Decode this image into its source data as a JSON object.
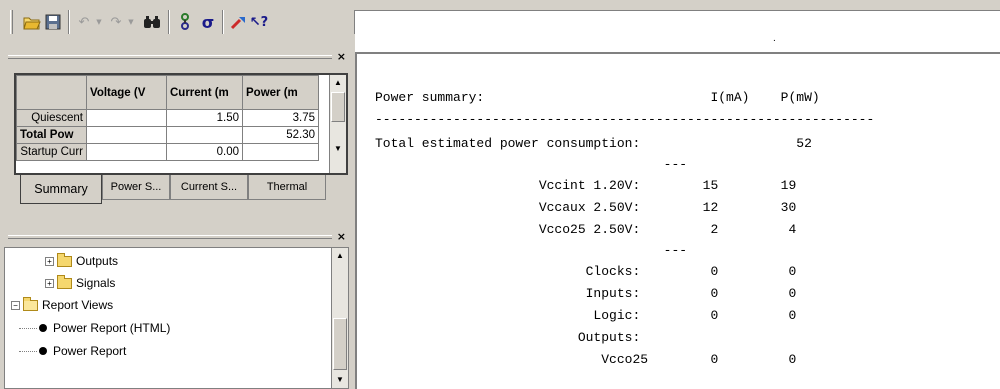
{
  "toolbar": {
    "icons": [
      "open-folder-icon",
      "save-icon",
      "undo-icon",
      "redo-icon",
      "find-icon",
      "hierarchy-icon",
      "sigma-icon",
      "run-icon",
      "help-pointer-icon"
    ],
    "sigma_label": "σ",
    "right_dot": "."
  },
  "summary_pane": {
    "columns": [
      "Voltage (V",
      "Current (m",
      "Power (m"
    ],
    "rows": [
      {
        "label": "Quiescent",
        "voltage": "",
        "current": "1.50",
        "power": "3.75"
      },
      {
        "label": "Total Pow",
        "voltage": "",
        "current": "",
        "power": "52.30"
      },
      {
        "label": "Startup Curr",
        "voltage": "",
        "current": "0.00",
        "power": ""
      }
    ],
    "tabs": [
      "Summary",
      "Power S...",
      "Current S...",
      "Thermal"
    ]
  },
  "tree_pane": {
    "nodes": [
      {
        "label": "Outputs",
        "type": "folder-collapsed"
      },
      {
        "label": "Signals",
        "type": "folder-collapsed"
      },
      {
        "label": "Report Views",
        "type": "folder-expanded"
      },
      {
        "label": "Power Report (HTML)",
        "type": "leaf"
      },
      {
        "label": "Power Report",
        "type": "leaf"
      }
    ]
  },
  "report": {
    "lines": [
      "Power summary:                             I(mA)    P(mW)",
      "----------------------------------------------------------------",
      "Total estimated power consumption:                    52",
      "                                     ---",
      "                     Vccint 1.20V:        15        19",
      "                     Vccaux 2.50V:        12        30",
      "                     Vcco25 2.50V:         2         4",
      "                                     ---",
      "                           Clocks:         0         0",
      "                           Inputs:         0         0",
      "                            Logic:         0         0",
      "                          Outputs:",
      "                             Vcco25        0         0"
    ]
  }
}
